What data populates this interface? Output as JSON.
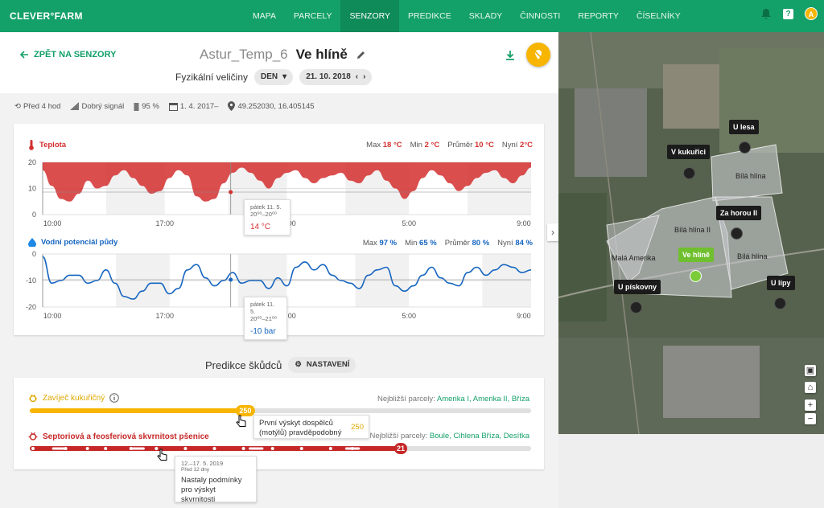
{
  "app": {
    "logo": "CLEVER°FARM",
    "avatar_initial": "A",
    "help_label": "?"
  },
  "nav": [
    {
      "label": "MAPA"
    },
    {
      "label": "PARCELY"
    },
    {
      "label": "SENZORY",
      "active": true
    },
    {
      "label": "PREDIKCE"
    },
    {
      "label": "SKLADY"
    },
    {
      "label": "ČINNOSTI"
    },
    {
      "label": "REPORTY"
    },
    {
      "label": "ČÍSELNÍKY"
    }
  ],
  "header": {
    "back": "ZPĚT NA SENZORY",
    "sensor_name": "Astur_Temp_6",
    "location": "Ve hlíně",
    "quantity_label": "Fyzikální veličiny",
    "period": "DEN",
    "date": "21. 10. 2018"
  },
  "info": {
    "last_update": "Před 4 hod",
    "signal": "Dobrý signál",
    "battery": "95 %",
    "since": "1. 4. 2017–",
    "coords": "49.252030, 16.405145"
  },
  "temperature": {
    "title": "Teplota",
    "max_label": "Max",
    "max": "18 °C",
    "min_label": "Min",
    "min": "2 °C",
    "avg_label": "Průměr",
    "avg": "10 °C",
    "now_label": "Nyní",
    "now": "2°C",
    "y_ticks": [
      "20",
      "10",
      "0"
    ],
    "x_ticks": [
      "10:00",
      "17:00",
      "24:00",
      "5:00",
      "9:00"
    ],
    "tooltip": {
      "date": "pátek 11. 5.",
      "time": "20⁰⁰–20⁰⁰",
      "value": "14 °C"
    },
    "color": "#d32f2f"
  },
  "water": {
    "title": "Vodní potenciál půdy",
    "max_label": "Max",
    "max": "97 %",
    "min_label": "Min",
    "min": "65 %",
    "avg_label": "Průměr",
    "avg": "80 %",
    "now_label": "Nyní",
    "now": "84 %",
    "y_ticks": [
      "0",
      "-10",
      "-20"
    ],
    "x_ticks": [
      "10:00",
      "17:00",
      "24:00",
      "5:00",
      "9:00"
    ],
    "tooltip": {
      "date": "pátek 11. 5.",
      "time": "20⁰⁰–21⁰⁰",
      "value": "-10 bar"
    },
    "color": "#1565c0"
  },
  "chart_data": [
    {
      "type": "area",
      "title": "Teplota",
      "ylim": [
        0,
        20
      ],
      "y": [
        17,
        11,
        6,
        5,
        8,
        13,
        10,
        11,
        15,
        17,
        14,
        11,
        8,
        9,
        14,
        17,
        15,
        7,
        5,
        6,
        12,
        16,
        18,
        16,
        13,
        10,
        14,
        16,
        17,
        14,
        12,
        14,
        15,
        16,
        13,
        12,
        15,
        17,
        13,
        10,
        6,
        9,
        14,
        17,
        15,
        12,
        9,
        11,
        14,
        16,
        17,
        14,
        12,
        15,
        18
      ]
    },
    {
      "type": "line",
      "title": "Vodní potenciál půdy",
      "ylim": [
        -20,
        0
      ],
      "y": [
        -1,
        -11,
        -10,
        -8,
        -8,
        -11,
        -10,
        -6,
        -11,
        -16,
        -17,
        -14,
        -11,
        -11,
        -15,
        -13,
        -6,
        -4,
        -9,
        -12,
        -10,
        -7,
        -11,
        -10,
        -10,
        -13,
        -9,
        -12,
        -5,
        -3,
        -6,
        -4,
        -8,
        -10,
        -11,
        -13,
        -8,
        -6,
        -5,
        -12,
        -14,
        -12,
        -8,
        -5,
        -9,
        -11,
        -12,
        -7,
        -5,
        -8,
        -6,
        -4,
        -5,
        -7,
        -6
      ]
    }
  ],
  "prediction": {
    "title": "Predikce škůdců",
    "settings": "NASTAVENÍ",
    "pests": [
      {
        "name": "Zavíječ kukuřičný",
        "near_label": "Nejbližší parcely:",
        "near": "Amerika I, Amerika II, Bříza",
        "value": "250",
        "progress": 0.43,
        "color": "#f7b500",
        "tip_text": "První výskyt dospělců (motýlů) pravděpodobný",
        "tip_value": "250"
      },
      {
        "name": "Septoriová a feosferiová skvrnitost pšenice",
        "near_label": "Nejbližší parcely:",
        "near": "Boule, Cihlena Bříza, Desítka",
        "value": "21",
        "progress": 0.74,
        "color": "#c62828",
        "tip_date": "12.–17. 5. 2019",
        "tip_ago": "Před 12 dny",
        "tip_text": "Nastaly podmínky pro výskyt skvrnitosti"
      }
    ]
  },
  "map": {
    "pins": [
      {
        "label": "U lesa"
      },
      {
        "label": "V kukuřici"
      },
      {
        "label": "Za horou II"
      },
      {
        "label": "Ve hlíně",
        "active": true
      },
      {
        "label": "U pískovny"
      },
      {
        "label": "U lípy"
      }
    ],
    "fields": [
      "Bílá hlína",
      "Bílá hlína II",
      "Bílá hlína",
      "Malá Amerika"
    ],
    "zoom_in": "+",
    "zoom_out": "−"
  }
}
